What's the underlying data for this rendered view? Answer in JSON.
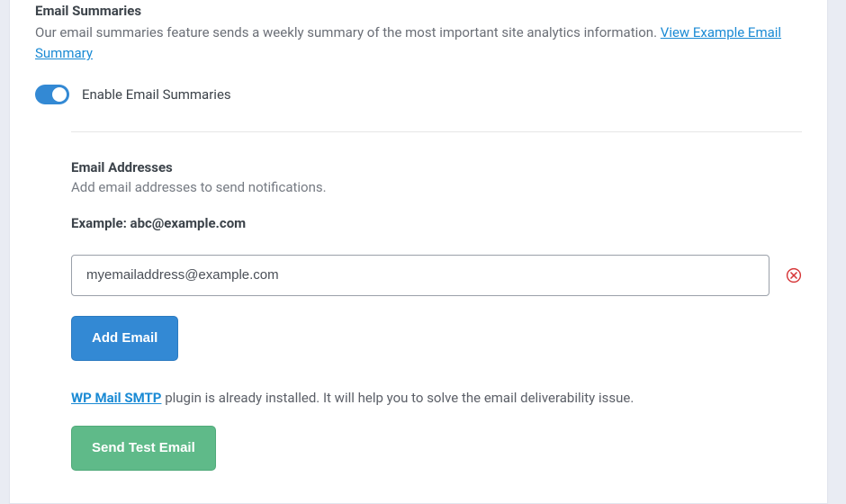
{
  "section": {
    "heading": "Email Summaries",
    "desc_prefix": "Our email summaries feature sends a weekly summary of the most important site analytics information. ",
    "view_example_link": "View Example Email Summary"
  },
  "toggle": {
    "label": "Enable Email Summaries",
    "enabled": true
  },
  "emails": {
    "heading": "Email Addresses",
    "desc": "Add email addresses to send notifications.",
    "example_label": "Example: abc@example.com",
    "items": [
      {
        "value": "myemailaddress@example.com"
      }
    ],
    "add_button": "Add Email"
  },
  "smtp": {
    "link_text": "WP Mail SMTP",
    "message_suffix": " plugin is already installed. It will help you to solve the email deliverability issue.",
    "send_test_button": "Send Test Email"
  }
}
